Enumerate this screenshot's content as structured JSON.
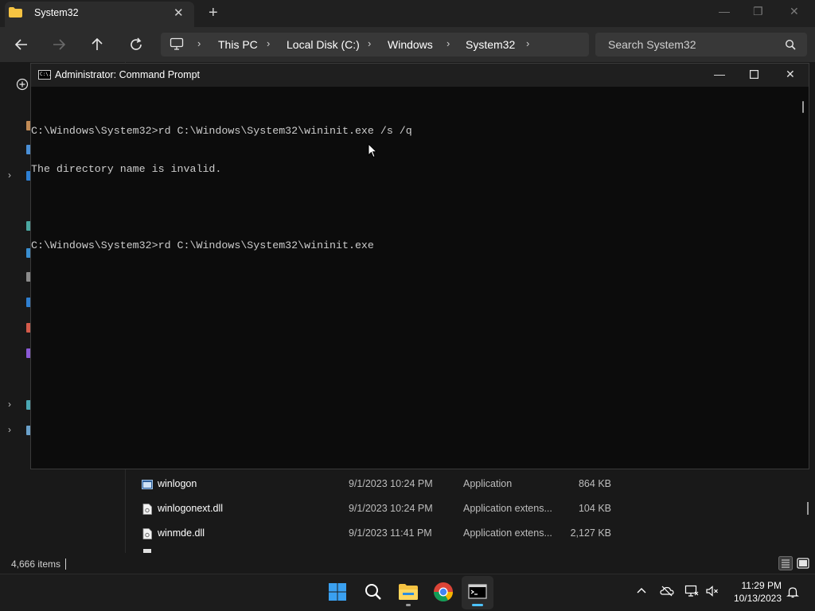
{
  "explorer": {
    "tab_title": "System32",
    "breadcrumbs": [
      "This PC",
      "Local Disk (C:)",
      "Windows",
      "System32"
    ],
    "search_placeholder": "Search System32",
    "files": [
      {
        "name": "winlogon",
        "date": "9/1/2023 10:24 PM",
        "type": "Application",
        "size": "864 KB"
      },
      {
        "name": "winlogonext.dll",
        "date": "9/1/2023 10:24 PM",
        "type": "Application extens...",
        "size": "104 KB"
      },
      {
        "name": "winmde.dll",
        "date": "9/1/2023 11:41 PM",
        "type": "Application extens...",
        "size": "2,127 KB"
      }
    ],
    "status": {
      "item_count": "4,666 items"
    }
  },
  "cmd": {
    "title": "Administrator: Command Prompt",
    "icon_text": "C:\\.",
    "lines": [
      "",
      "C:\\Windows\\System32>rd C:\\Windows\\System32\\wininit.exe /s /q",
      "The directory name is invalid.",
      "",
      "C:\\Windows\\System32>rd C:\\Windows\\System32\\wininit.exe"
    ]
  },
  "taskbar": {
    "apps": [
      "start-icon",
      "search-icon",
      "file-explorer-icon",
      "chrome-icon",
      "terminal-icon"
    ],
    "clock": {
      "time": "11:29 PM",
      "date": "10/13/2023"
    }
  },
  "colors": {
    "accent": "#0078d4",
    "folder": "#f5c342",
    "console_bg": "#0c0c0c"
  }
}
